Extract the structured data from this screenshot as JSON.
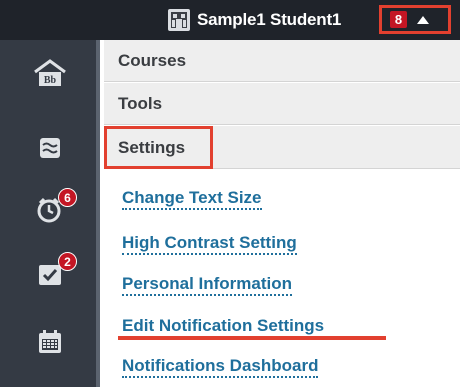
{
  "header": {
    "user_name": "Sample1 Student1",
    "notification_count": "8"
  },
  "sidebar": {
    "items": [
      {
        "icon": "home-institution-icon"
      },
      {
        "icon": "activity-stream-icon"
      },
      {
        "icon": "due-dates-icon",
        "badge": "6"
      },
      {
        "icon": "grades-icon",
        "badge": "2"
      },
      {
        "icon": "calendar-icon"
      }
    ]
  },
  "menu": {
    "sections": [
      "Courses",
      "Tools",
      "Settings"
    ],
    "settings_links": [
      "Change Text Size",
      "High Contrast Setting",
      "Personal Information",
      "Edit Notification Settings",
      "Notifications Dashboard"
    ]
  },
  "colors": {
    "highlight": "#e2402f",
    "link": "#1f6f9c",
    "badge": "#c41624",
    "topbar": "#1f232a",
    "sidebar": "#343a44"
  }
}
